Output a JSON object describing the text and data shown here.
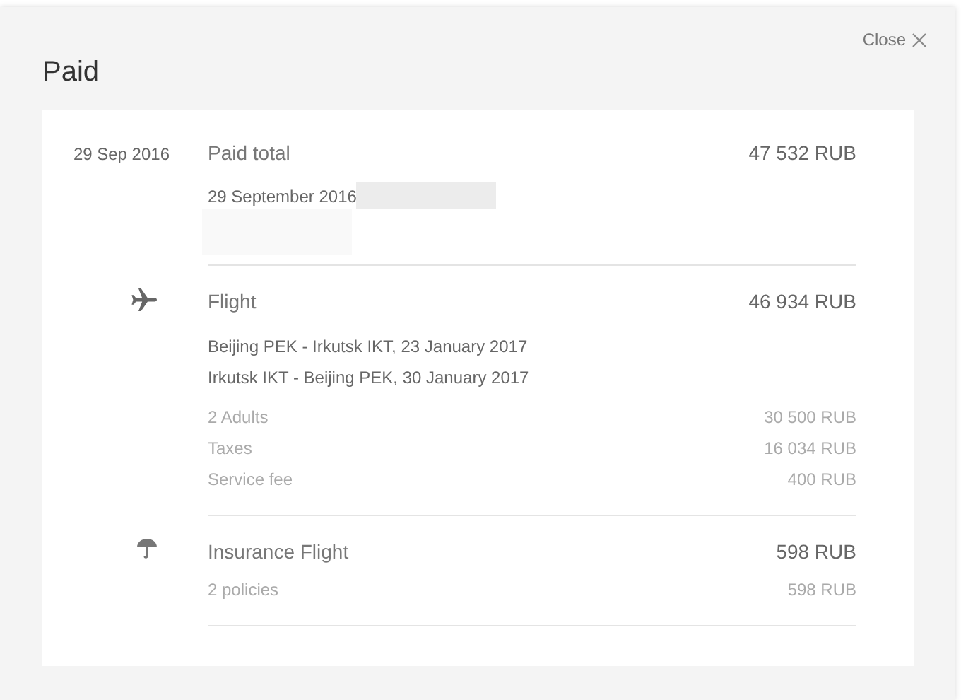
{
  "dialog": {
    "title": "Paid",
    "close": "Close"
  },
  "payment": {
    "date": "29 Sep 2016",
    "label": "Paid total",
    "amount": "47 532 RUB",
    "detail": "29 September 2016"
  },
  "sections": [
    {
      "kind": "flight",
      "title": "Flight",
      "amount": "46 934 RUB",
      "routes": [
        "Beijing PEK - Irkutsk IKT, 23 January 2017",
        "Irkutsk IKT - Beijing PEK, 30 January 2017"
      ],
      "lines": [
        {
          "label": "2 Adults",
          "amount": "30 500 RUB"
        },
        {
          "label": "Taxes",
          "amount": "16 034 RUB"
        },
        {
          "label": "Service fee",
          "amount": "400 RUB"
        }
      ]
    },
    {
      "kind": "insurance",
      "title": "Insurance Flight",
      "amount": "598 RUB",
      "lines": [
        {
          "label": "2 policies",
          "amount": "598 RUB"
        }
      ]
    }
  ]
}
